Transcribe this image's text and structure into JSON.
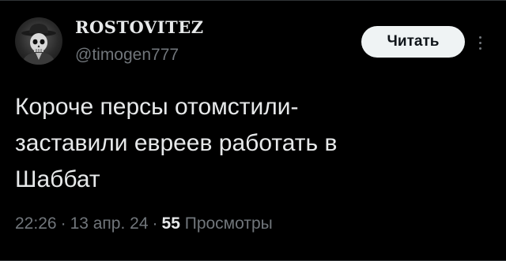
{
  "tweet": {
    "author": {
      "display_name": "ROSTOVITEZ",
      "handle": "@timogen777",
      "avatar_icon": "skull-cowboy-avatar"
    },
    "follow_label": "Читать",
    "more_icon": "more-vertical-icon",
    "text": "Короче персы отомстили-\nзаставили евреев работать в\nШаббат",
    "time": "22:26",
    "date": "13 апр. 24",
    "separator": "·",
    "views_count": "55",
    "views_label": "Просмотры"
  },
  "colors": {
    "background": "#000000",
    "text_primary": "#e7e9ea",
    "text_secondary": "#71767b",
    "button_bg": "#eff3f4",
    "button_text": "#0f1419",
    "divider": "#2f3336"
  }
}
